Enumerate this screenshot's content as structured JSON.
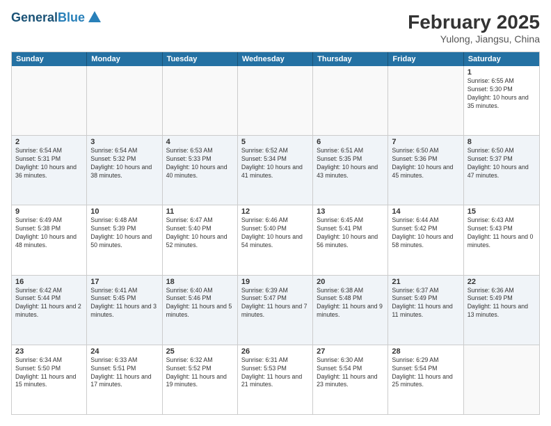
{
  "header": {
    "logo_line1": "General",
    "logo_line2": "Blue",
    "title": "February 2025",
    "subtitle": "Yulong, Jiangsu, China"
  },
  "days_of_week": [
    "Sunday",
    "Monday",
    "Tuesday",
    "Wednesday",
    "Thursday",
    "Friday",
    "Saturday"
  ],
  "weeks": [
    [
      {
        "day": "",
        "info": "",
        "empty": true
      },
      {
        "day": "",
        "info": "",
        "empty": true
      },
      {
        "day": "",
        "info": "",
        "empty": true
      },
      {
        "day": "",
        "info": "",
        "empty": true
      },
      {
        "day": "",
        "info": "",
        "empty": true
      },
      {
        "day": "",
        "info": "",
        "empty": true
      },
      {
        "day": "1",
        "info": "Sunrise: 6:55 AM\nSunset: 5:30 PM\nDaylight: 10 hours\nand 35 minutes.",
        "empty": false
      }
    ],
    [
      {
        "day": "2",
        "info": "Sunrise: 6:54 AM\nSunset: 5:31 PM\nDaylight: 10 hours\nand 36 minutes.",
        "empty": false
      },
      {
        "day": "3",
        "info": "Sunrise: 6:54 AM\nSunset: 5:32 PM\nDaylight: 10 hours\nand 38 minutes.",
        "empty": false
      },
      {
        "day": "4",
        "info": "Sunrise: 6:53 AM\nSunset: 5:33 PM\nDaylight: 10 hours\nand 40 minutes.",
        "empty": false
      },
      {
        "day": "5",
        "info": "Sunrise: 6:52 AM\nSunset: 5:34 PM\nDaylight: 10 hours\nand 41 minutes.",
        "empty": false
      },
      {
        "day": "6",
        "info": "Sunrise: 6:51 AM\nSunset: 5:35 PM\nDaylight: 10 hours\nand 43 minutes.",
        "empty": false
      },
      {
        "day": "7",
        "info": "Sunrise: 6:50 AM\nSunset: 5:36 PM\nDaylight: 10 hours\nand 45 minutes.",
        "empty": false
      },
      {
        "day": "8",
        "info": "Sunrise: 6:50 AM\nSunset: 5:37 PM\nDaylight: 10 hours\nand 47 minutes.",
        "empty": false
      }
    ],
    [
      {
        "day": "9",
        "info": "Sunrise: 6:49 AM\nSunset: 5:38 PM\nDaylight: 10 hours\nand 48 minutes.",
        "empty": false
      },
      {
        "day": "10",
        "info": "Sunrise: 6:48 AM\nSunset: 5:39 PM\nDaylight: 10 hours\nand 50 minutes.",
        "empty": false
      },
      {
        "day": "11",
        "info": "Sunrise: 6:47 AM\nSunset: 5:40 PM\nDaylight: 10 hours\nand 52 minutes.",
        "empty": false
      },
      {
        "day": "12",
        "info": "Sunrise: 6:46 AM\nSunset: 5:40 PM\nDaylight: 10 hours\nand 54 minutes.",
        "empty": false
      },
      {
        "day": "13",
        "info": "Sunrise: 6:45 AM\nSunset: 5:41 PM\nDaylight: 10 hours\nand 56 minutes.",
        "empty": false
      },
      {
        "day": "14",
        "info": "Sunrise: 6:44 AM\nSunset: 5:42 PM\nDaylight: 10 hours\nand 58 minutes.",
        "empty": false
      },
      {
        "day": "15",
        "info": "Sunrise: 6:43 AM\nSunset: 5:43 PM\nDaylight: 11 hours\nand 0 minutes.",
        "empty": false
      }
    ],
    [
      {
        "day": "16",
        "info": "Sunrise: 6:42 AM\nSunset: 5:44 PM\nDaylight: 11 hours\nand 2 minutes.",
        "empty": false
      },
      {
        "day": "17",
        "info": "Sunrise: 6:41 AM\nSunset: 5:45 PM\nDaylight: 11 hours\nand 3 minutes.",
        "empty": false
      },
      {
        "day": "18",
        "info": "Sunrise: 6:40 AM\nSunset: 5:46 PM\nDaylight: 11 hours\nand 5 minutes.",
        "empty": false
      },
      {
        "day": "19",
        "info": "Sunrise: 6:39 AM\nSunset: 5:47 PM\nDaylight: 11 hours\nand 7 minutes.",
        "empty": false
      },
      {
        "day": "20",
        "info": "Sunrise: 6:38 AM\nSunset: 5:48 PM\nDaylight: 11 hours\nand 9 minutes.",
        "empty": false
      },
      {
        "day": "21",
        "info": "Sunrise: 6:37 AM\nSunset: 5:49 PM\nDaylight: 11 hours\nand 11 minutes.",
        "empty": false
      },
      {
        "day": "22",
        "info": "Sunrise: 6:36 AM\nSunset: 5:49 PM\nDaylight: 11 hours\nand 13 minutes.",
        "empty": false
      }
    ],
    [
      {
        "day": "23",
        "info": "Sunrise: 6:34 AM\nSunset: 5:50 PM\nDaylight: 11 hours\nand 15 minutes.",
        "empty": false
      },
      {
        "day": "24",
        "info": "Sunrise: 6:33 AM\nSunset: 5:51 PM\nDaylight: 11 hours\nand 17 minutes.",
        "empty": false
      },
      {
        "day": "25",
        "info": "Sunrise: 6:32 AM\nSunset: 5:52 PM\nDaylight: 11 hours\nand 19 minutes.",
        "empty": false
      },
      {
        "day": "26",
        "info": "Sunrise: 6:31 AM\nSunset: 5:53 PM\nDaylight: 11 hours\nand 21 minutes.",
        "empty": false
      },
      {
        "day": "27",
        "info": "Sunrise: 6:30 AM\nSunset: 5:54 PM\nDaylight: 11 hours\nand 23 minutes.",
        "empty": false
      },
      {
        "day": "28",
        "info": "Sunrise: 6:29 AM\nSunset: 5:54 PM\nDaylight: 11 hours\nand 25 minutes.",
        "empty": false
      },
      {
        "day": "",
        "info": "",
        "empty": true
      }
    ]
  ]
}
